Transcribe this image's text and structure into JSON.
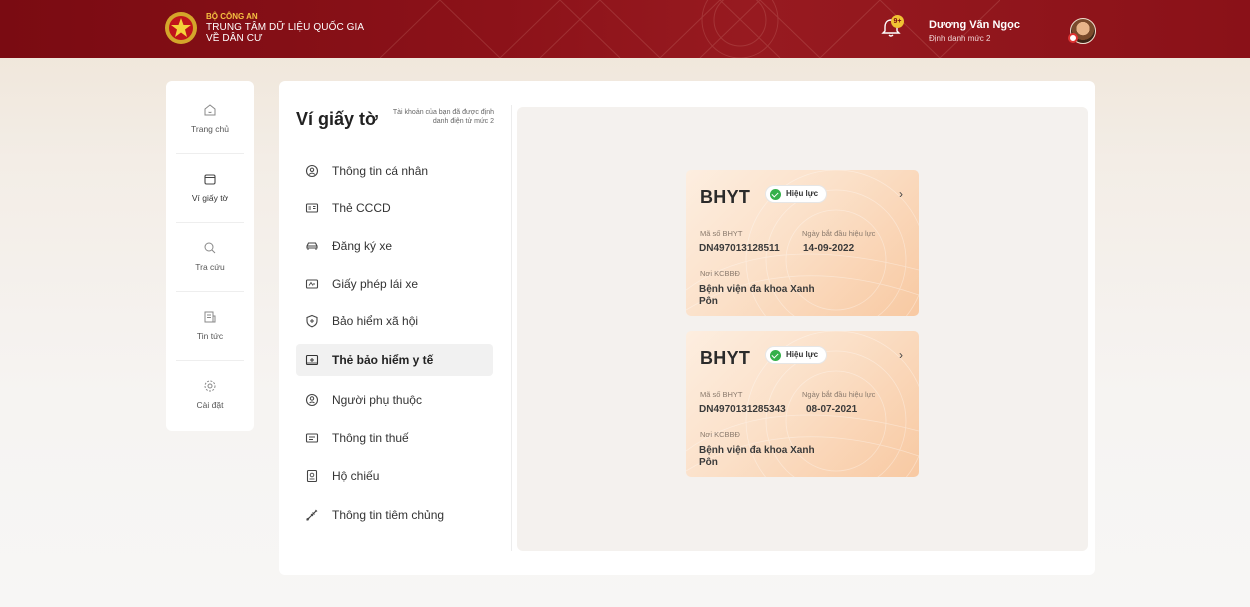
{
  "header": {
    "org_top": "BỘ CÔNG AN",
    "org_line1": "TRUNG TÂM DỮ LIỆU QUỐC GIA",
    "org_line2": "VỀ DÂN CƯ",
    "notification_count": "9+",
    "user_name": "Dương Văn Ngọc",
    "user_level": "Định danh mức 2",
    "brand_color": "#8c1219"
  },
  "nav": [
    {
      "label": "Trang chủ",
      "icon": "home-icon"
    },
    {
      "label": "Ví giấy tờ",
      "icon": "wallet-icon"
    },
    {
      "label": "Tra cứu",
      "icon": "search-icon"
    },
    {
      "label": "Tin tức",
      "icon": "news-icon"
    },
    {
      "label": "Cài đặt",
      "icon": "settings-icon"
    }
  ],
  "wallet": {
    "title": "Ví giấy tờ",
    "note": "Tài khoản của bạn đã được định danh điện tử mức 2"
  },
  "menu": [
    {
      "label": "Thông tin cá nhân",
      "icon": "person-icon"
    },
    {
      "label": "Thẻ CCCD",
      "icon": "id-card-icon"
    },
    {
      "label": "Đăng ký xe",
      "icon": "car-icon"
    },
    {
      "label": "Giấy phép lái xe",
      "icon": "license-icon"
    },
    {
      "label": "Bảo hiểm xã hội",
      "icon": "shield-plus-icon"
    },
    {
      "label": "Thẻ bảo hiểm y tế",
      "icon": "health-card-icon",
      "active": true
    },
    {
      "label": "Người phụ thuộc",
      "icon": "dependent-icon"
    },
    {
      "label": "Thông tin thuế",
      "icon": "tax-icon"
    },
    {
      "label": "Hộ chiếu",
      "icon": "passport-icon"
    },
    {
      "label": "Thông tin tiêm chủng",
      "icon": "syringe-icon"
    }
  ],
  "cards": [
    {
      "title": "BHYT",
      "status": "Hiệu lực",
      "code_label": "Mã số BHYT",
      "code": "DN497013128511",
      "date_label": "Ngày bắt đầu hiệu lực",
      "date": "14-09-2022",
      "place_label": "Nơi KCBBĐ",
      "place": "Bệnh viện đa khoa Xanh Pôn"
    },
    {
      "title": "BHYT",
      "status": "Hiệu lực",
      "code_label": "Mã số BHYT",
      "code": "DN4970131285343",
      "date_label": "Ngày bắt đầu hiệu lực",
      "date": "08-07-2021",
      "place_label": "Nơi KCBBĐ",
      "place": "Bệnh viện đa khoa Xanh Pôn"
    }
  ]
}
